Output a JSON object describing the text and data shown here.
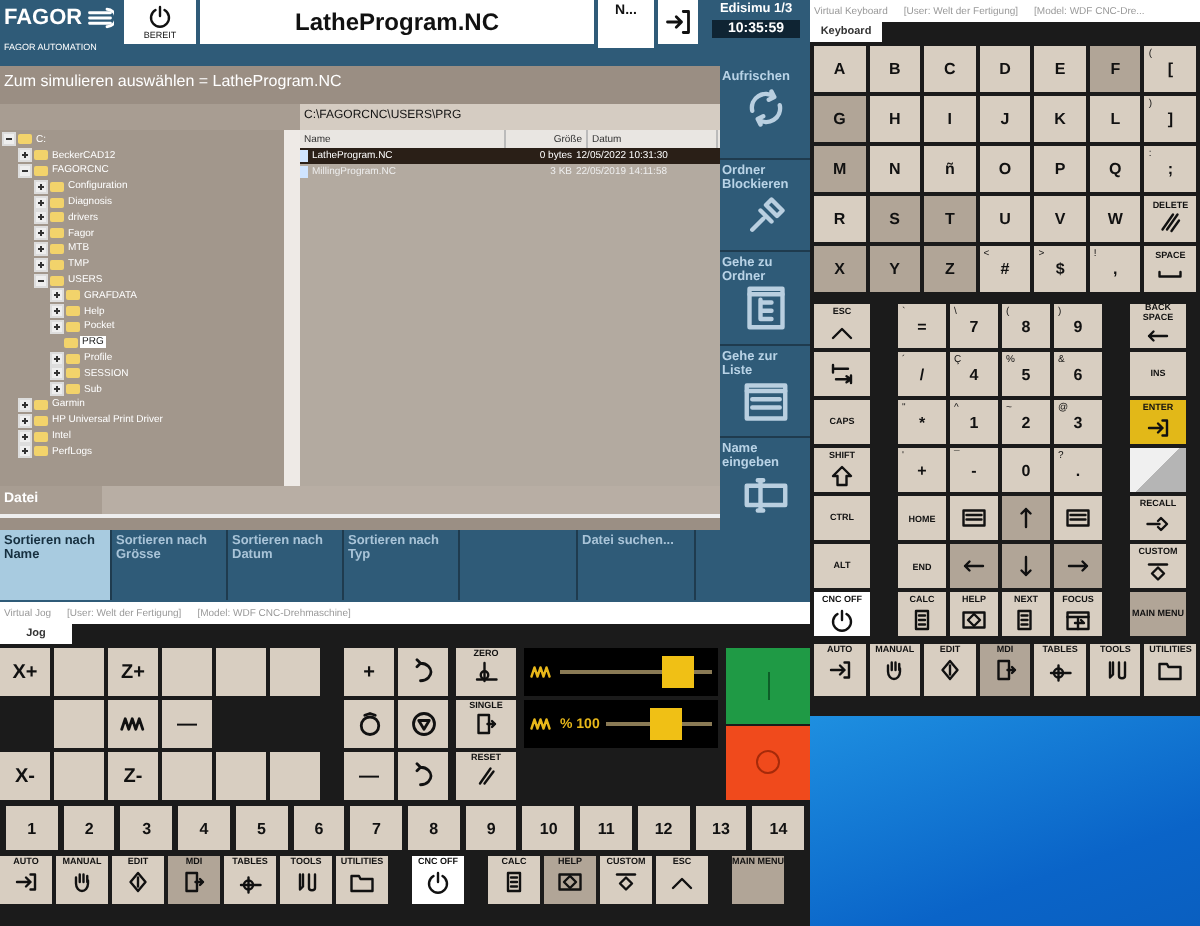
{
  "app": {
    "logo": "FAGOR",
    "company": "FAGOR AUTOMATION",
    "status": "BEREIT",
    "program": "LatheProgram.NC",
    "short_field": "N...",
    "mode": "Edisimu 1/3",
    "time": "10:35:59",
    "dialog_title": "Zum simulieren auswählen = LatheProgram.NC",
    "path": "C:\\FAGORCNC\\USERS\\PRG",
    "tree": [
      {
        "label": "C:",
        "expanded": true,
        "selected": false,
        "children": [
          {
            "label": "BeckerCAD12",
            "expanded": false,
            "selected": false
          },
          {
            "label": "FAGORCNC",
            "expanded": true,
            "selected": false,
            "children": [
              {
                "label": "Configuration",
                "expanded": false,
                "selected": false
              },
              {
                "label": "Diagnosis",
                "expanded": false,
                "selected": false
              },
              {
                "label": "drivers",
                "expanded": false,
                "selected": false
              },
              {
                "label": "Fagor",
                "expanded": false,
                "selected": false
              },
              {
                "label": "MTB",
                "expanded": false,
                "selected": false
              },
              {
                "label": "TMP",
                "expanded": false,
                "selected": false
              },
              {
                "label": "USERS",
                "expanded": true,
                "selected": false,
                "children": [
                  {
                    "label": "GRAFDATA",
                    "expanded": false,
                    "selected": false
                  },
                  {
                    "label": "Help",
                    "expanded": false,
                    "selected": false
                  },
                  {
                    "label": "Pocket",
                    "expanded": false,
                    "selected": false
                  },
                  {
                    "label": "PRG",
                    "selected": true
                  },
                  {
                    "label": "Profile",
                    "expanded": false,
                    "selected": false
                  },
                  {
                    "label": "SESSION",
                    "expanded": false,
                    "selected": false
                  },
                  {
                    "label": "Sub",
                    "expanded": false,
                    "selected": false
                  }
                ]
              }
            ]
          },
          {
            "label": "Garmin",
            "expanded": false,
            "selected": false
          },
          {
            "label": "HP Universal Print Driver",
            "expanded": false,
            "selected": false
          },
          {
            "label": "Intel",
            "expanded": false,
            "selected": false
          },
          {
            "label": "PerfLogs",
            "expanded": false,
            "selected": false
          }
        ]
      }
    ],
    "columns": [
      "Name",
      "Größe",
      "Datum"
    ],
    "files": [
      {
        "name": "LatheProgram.NC",
        "size": "0 bytes",
        "date": "12/05/2022 10:31:30",
        "selected": true
      },
      {
        "name": "MillingProgram.NC",
        "size": "3 KB",
        "date": "22/05/2019 14:11:58",
        "selected": false
      }
    ],
    "file_label": "Datei",
    "side_softkeys": [
      "Aufrischen",
      "Ordner Blockieren",
      "Gehe zu Ordner",
      "Gehe zur Liste",
      "Name eingeben"
    ],
    "bottom_softkeys": [
      {
        "label": "Sortieren nach Name",
        "selected": true
      },
      {
        "label": "Sortieren nach Grösse",
        "selected": false
      },
      {
        "label": "Sortieren nach Datum",
        "selected": false
      },
      {
        "label": "Sortieren nach Typ",
        "selected": false
      },
      {
        "label": "Datei suchen...",
        "selected": false
      }
    ]
  },
  "keyboard": {
    "title": "Virtual Keyboard",
    "user": "[User: Welt der Fertigung]",
    "model": "[Model: WDF CNC-Dre...",
    "tab": "Keyboard",
    "letters": [
      {
        "label": "A",
        "highlighted": false
      },
      {
        "label": "B",
        "highlighted": false
      },
      {
        "label": "C",
        "highlighted": false
      },
      {
        "label": "D",
        "highlighted": false
      },
      {
        "label": "E",
        "highlighted": false
      },
      {
        "label": "F",
        "highlighted": true
      },
      {
        "label": "[",
        "shift": "(",
        "highlighted": false
      },
      {
        "label": "G",
        "highlighted": true
      },
      {
        "label": "H",
        "highlighted": false
      },
      {
        "label": "I",
        "highlighted": false
      },
      {
        "label": "J",
        "highlighted": false
      },
      {
        "label": "K",
        "highlighted": false
      },
      {
        "label": "L",
        "highlighted": false
      },
      {
        "label": "]",
        "shift": ")",
        "highlighted": false
      },
      {
        "label": "M",
        "highlighted": true
      },
      {
        "label": "N",
        "highlighted": false
      },
      {
        "label": "ñ",
        "highlighted": false
      },
      {
        "label": "O",
        "highlighted": false
      },
      {
        "label": "P",
        "highlighted": false
      },
      {
        "label": "Q",
        "highlighted": false
      },
      {
        "label": ";",
        "shift": ":",
        "highlighted": false
      },
      {
        "label": "R",
        "highlighted": false
      },
      {
        "label": "S",
        "highlighted": true
      },
      {
        "label": "T",
        "highlighted": true
      },
      {
        "label": "U",
        "highlighted": false
      },
      {
        "label": "V",
        "highlighted": false
      },
      {
        "label": "W",
        "highlighted": false
      },
      {
        "label": "DELETE",
        "highlighted": false
      },
      {
        "label": "X",
        "highlighted": true
      },
      {
        "label": "Y",
        "highlighted": true
      },
      {
        "label": "Z",
        "highlighted": true
      },
      {
        "label": "#",
        "shift": "<",
        "highlighted": false
      },
      {
        "label": "$",
        "shift": ">",
        "highlighted": false
      },
      {
        "label": ",",
        "shift": "!",
        "highlighted": false
      },
      {
        "label": "SPACE",
        "highlighted": false
      }
    ],
    "left_keys": [
      {
        "kind": "label",
        "label": "ESC"
      },
      {
        "kind": "icon"
      },
      {
        "kind": "label",
        "label": "CAPS"
      },
      {
        "kind": "label",
        "label": "SHIFT"
      },
      {
        "kind": "label",
        "label": "CTRL"
      },
      {
        "kind": "label",
        "label": "ALT"
      }
    ],
    "numpad": [
      {
        "label": "=",
        "shift": "`",
        "highlighted": false
      },
      {
        "label": "7",
        "shift": "\\",
        "highlighted": false
      },
      {
        "label": "8",
        "shift": "(",
        "highlighted": false
      },
      {
        "label": "9",
        "shift": ")",
        "highlighted": false
      },
      {
        "label": "/",
        "shift": "´",
        "highlighted": false
      },
      {
        "label": "4",
        "shift": "Ç",
        "highlighted": false
      },
      {
        "label": "5",
        "shift": "%",
        "highlighted": false
      },
      {
        "label": "6",
        "shift": "&",
        "highlighted": false
      },
      {
        "label": "*",
        "shift": "\"",
        "highlighted": false
      },
      {
        "label": "1",
        "shift": "^",
        "highlighted": false
      },
      {
        "label": "2",
        "shift": "~",
        "highlighted": false
      },
      {
        "label": "3",
        "shift": "@",
        "highlighted": false
      },
      {
        "label": "+",
        "shift": "'",
        "highlighted": false
      },
      {
        "label": "-",
        "shift": "¯",
        "highlighted": false
      },
      {
        "label": "0",
        "highlighted": false
      },
      {
        "label": ".",
        "shift": "?",
        "highlighted": false
      },
      {
        "label": "HOME",
        "highlighted": false
      },
      {
        "highlighted": false
      },
      {
        "highlighted": true
      },
      {
        "highlighted": false
      },
      {
        "label": "END",
        "highlighted": false
      },
      {
        "highlighted": true
      },
      {
        "highlighted": true
      },
      {
        "highlighted": true
      }
    ],
    "right_keys": [
      {
        "label": "BACK SPACE",
        "kind": "normal"
      },
      {
        "label": "INS",
        "kind": "normal"
      },
      {
        "label": "ENTER",
        "kind": "enter"
      },
      {
        "kind": "disabled"
      },
      {
        "label": "RECALL",
        "kind": "normal"
      },
      {
        "label": "CUSTOM",
        "kind": "normal"
      }
    ],
    "function_keys": [
      {
        "label": "CNC OFF",
        "highlighted": false
      },
      {
        "label": "CALC",
        "highlighted": false
      },
      {
        "label": "HELP",
        "highlighted": false
      },
      {
        "label": "NEXT",
        "highlighted": false
      },
      {
        "label": "FOCUS",
        "highlighted": false
      },
      {
        "label": "MAIN MENU",
        "highlighted": true
      }
    ],
    "mode_keys": [
      {
        "label": "AUTO",
        "highlighted": false
      },
      {
        "label": "MANUAL",
        "highlighted": false
      },
      {
        "label": "EDIT",
        "highlighted": false
      },
      {
        "label": "MDI",
        "highlighted": true
      },
      {
        "label": "TABLES",
        "highlighted": false
      },
      {
        "label": "TOOLS",
        "highlighted": false
      },
      {
        "label": "UTILITIES",
        "highlighted": false
      }
    ]
  },
  "jog": {
    "title": "Virtual Jog",
    "user": "[User: Welt der Fertigung]",
    "model": "[Model: WDF CNC-Drehmaschine]",
    "tab": "Jog",
    "axis_keys": [
      {
        "kind": "key",
        "label": "X+"
      },
      {
        "kind": "blank"
      },
      {
        "kind": "key",
        "label": "Z+"
      },
      {
        "kind": "blank"
      },
      {
        "kind": "blank"
      },
      {
        "kind": "blank"
      },
      {
        "kind": "none"
      },
      {
        "kind": "blank"
      },
      {
        "kind": "icon"
      },
      {
        "kind": "key",
        "label": "—"
      },
      {
        "kind": "none"
      },
      {
        "kind": "none"
      },
      {
        "kind": "key",
        "label": "X-"
      },
      {
        "kind": "blank"
      },
      {
        "kind": "key",
        "label": "Z-"
      },
      {
        "kind": "blank"
      },
      {
        "kind": "blank"
      },
      {
        "kind": "blank"
      }
    ],
    "spindle_keys": [
      {
        "kind": "key",
        "label": "+"
      },
      {
        "kind": "icon"
      },
      {
        "kind": "icon"
      },
      {
        "kind": "icon"
      },
      {
        "kind": "key",
        "label": "—"
      },
      {
        "kind": "icon"
      }
    ],
    "cycle_keys": [
      "ZERO",
      "SINGLE",
      "RESET"
    ],
    "feed": {
      "level": 0.85
    },
    "spindle": {
      "reading": "% 100",
      "level": 0.6
    },
    "numbers": [
      "1",
      "2",
      "3",
      "4",
      "5",
      "6",
      "7",
      "8",
      "9",
      "10",
      "11",
      "12",
      "13",
      "14"
    ],
    "bottom_keys": [
      {
        "label": "AUTO",
        "highlighted": false
      },
      {
        "label": "MANUAL",
        "highlighted": false
      },
      {
        "label": "EDIT",
        "highlighted": false
      },
      {
        "label": "MDI",
        "highlighted": true
      },
      {
        "label": "TABLES",
        "highlighted": false
      },
      {
        "label": "TOOLS",
        "highlighted": false
      },
      {
        "label": "UTILITIES",
        "highlighted": false
      },
      {
        "label": "CNC OFF",
        "highlighted": false
      },
      {
        "label": "CALC",
        "highlighted": false
      },
      {
        "label": "HELP",
        "highlighted": true
      },
      {
        "label": "CUSTOM",
        "highlighted": false
      },
      {
        "label": "ESC",
        "highlighted": false
      },
      {
        "label": "MAIN MENU",
        "highlighted": true
      }
    ]
  }
}
